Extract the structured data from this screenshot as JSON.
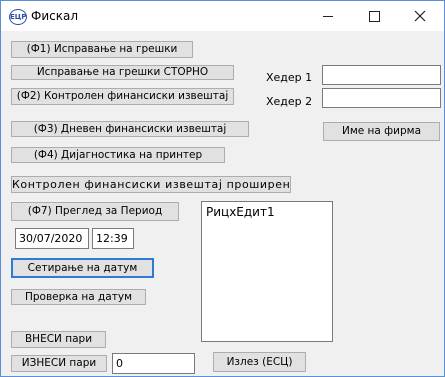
{
  "window": {
    "title": "Фискал",
    "icon": "ecr-app-icon",
    "icon_text": "ЕЦР"
  },
  "buttons": {
    "f1_error_correction": "(Ф1) Исправање на грешки",
    "storno_correction": "Исправање на грешки  СТОРНО",
    "f2_control_report": "(Ф2) Контролен финансиски извештај",
    "f3_daily_report": "(Ф3) Дневен финансиски извештај",
    "f4_printer_diag": "(Ф4) Дијагностика на принтер",
    "control_report_extended": "Контролен финансиски извештај проширен",
    "f7_period_review": "(Ф7) Преглед за Период",
    "set_date": "Сетирање на датум",
    "check_date": "Проверка на датум",
    "cash_in": "ВНЕСИ пари",
    "cash_out": "ИЗНЕСИ пари",
    "exit": "Излез   (ЕСЦ)",
    "company_name": "Име на фирма"
  },
  "fields": {
    "header1_label": "Хедер 1",
    "header1_value": "",
    "header2_label": "Хедер 2",
    "header2_value": "",
    "date_value": "30/07/2020",
    "time_value": "12:39",
    "cash_amount_value": "0"
  },
  "memo": {
    "text": "РицхЕдит1"
  }
}
